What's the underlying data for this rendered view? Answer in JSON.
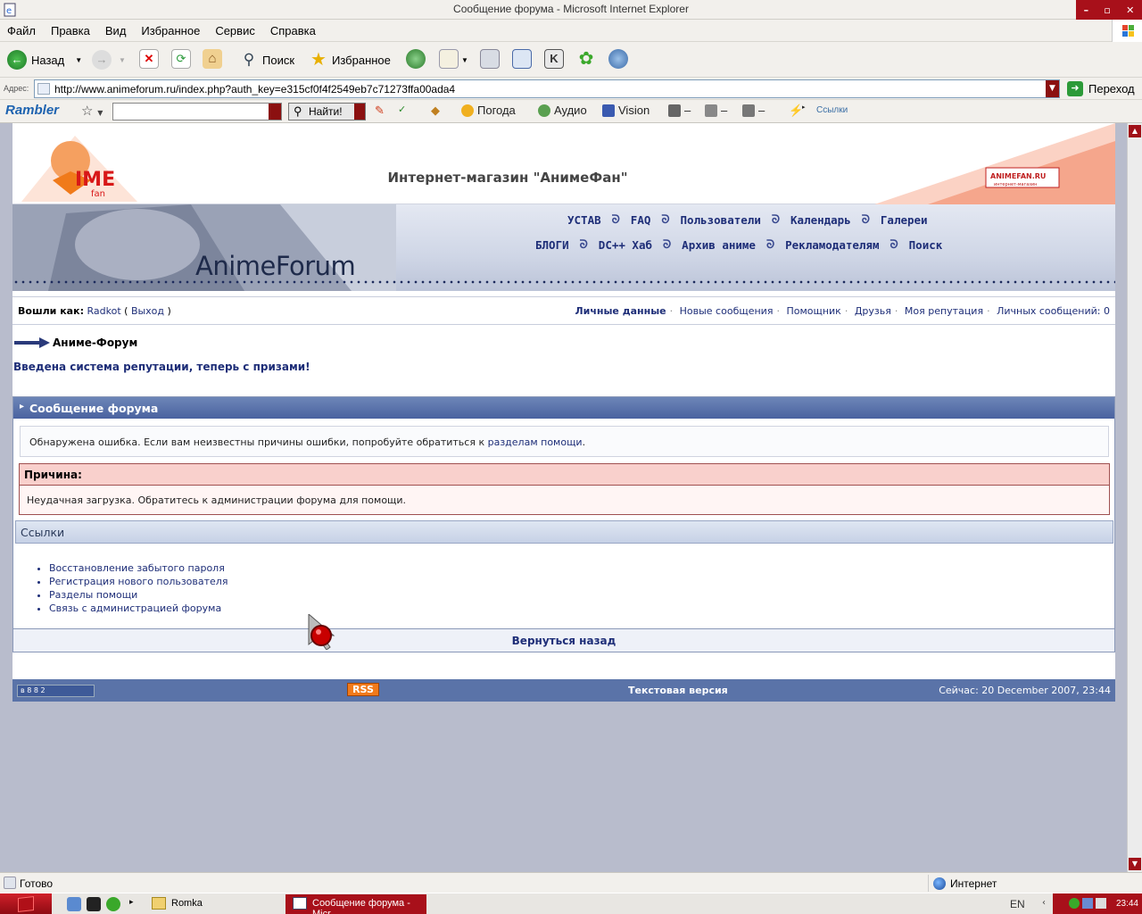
{
  "window": {
    "title": "Сообщение форума - Microsoft Internet Explorer"
  },
  "menu": [
    "Файл",
    "Правка",
    "Вид",
    "Избранное",
    "Сервис",
    "Справка"
  ],
  "toolbar": {
    "back_label": "Назад",
    "search_label": "Поиск",
    "favorites_label": "Избранное"
  },
  "address": {
    "label": "Адрес:",
    "url": "http://www.animeforum.ru/index.php?auth_key=e315cf0f4f2549eb7c71273ffa00ada4",
    "go_label": "Переход"
  },
  "rambler": {
    "logo": "Rambler",
    "find_label": "Найти!",
    "weather": "Погода",
    "audio": "Аудио",
    "vision": "Vision",
    "dash1": "–",
    "dash2": "–",
    "dash3": "–",
    "links": "Ссылки"
  },
  "forum": {
    "shop_title": "Интернет-магазин \"АнимеФан\"",
    "forum_name": "AnimeForum",
    "nav_row1": [
      "УСТАВ",
      "FAQ",
      "Пользователи",
      "Календарь",
      "Галереи"
    ],
    "nav_row2": [
      "БЛОГИ",
      "DC++ Хаб",
      "Архив аниме",
      "Рекламодателям",
      "Поиск"
    ],
    "userbar": {
      "logged_in": "Вошли как:",
      "username": "Radkot",
      "logout_open": "(",
      "logout": "Выход",
      "logout_close": ")",
      "right_links": [
        "Личные данные",
        "Новые сообщения",
        "Помощник",
        "Друзья",
        "Моя репутация",
        "Личных сообщений: 0"
      ]
    },
    "breadcrumb": "Аниме-Форум",
    "announcement": "Введена система репутации, теперь с призами!",
    "message": {
      "header": "Сообщение форума",
      "error_text": "Обнаружена ошибка. Если вам неизвестны причины ошибки, попробуйте обратиться к ",
      "error_link": "разделам помощи",
      "error_end": ".",
      "reason_head": "Причина:",
      "reason_body": "Неудачная загрузка. Обратитесь к администрации форума для помощи.",
      "links_head": "Ссылки",
      "links": [
        "Восстановление забытого пароля",
        "Регистрация нового пользователя",
        "Разделы помощи",
        "Связь с администрацией форума"
      ],
      "back": "Вернуться назад"
    },
    "footer": {
      "counter": "в 8 8 2",
      "rss": "RSS",
      "text_version": "Текстовая версия",
      "now": "Сейчас: 20 December 2007, 23:44"
    }
  },
  "status": {
    "text": "Готово",
    "zone": "Интернет"
  },
  "taskbar": {
    "task1": "Romka",
    "task2": "Сообщение форума - Micr...",
    "lang": "EN",
    "clock": "23:44"
  }
}
